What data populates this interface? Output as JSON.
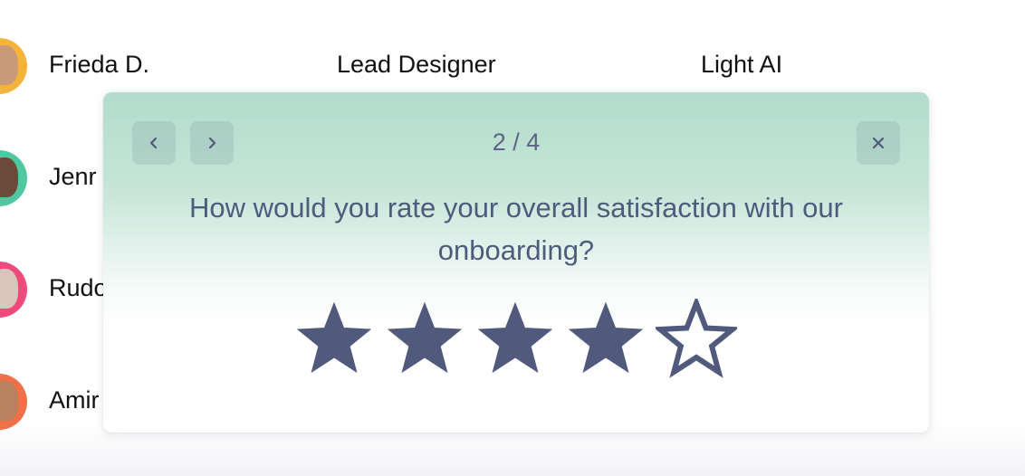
{
  "people": [
    {
      "name": "Frieda D.",
      "role": "Lead Designer",
      "company": "Light AI",
      "avatar_color": "#f4b43c"
    },
    {
      "name": "Jenr",
      "role": "",
      "company": "",
      "avatar_color": "#4fc7a0"
    },
    {
      "name": "Rudo",
      "role": "",
      "company": "",
      "avatar_color": "#ef4a7c"
    },
    {
      "name": "Amir",
      "role": "",
      "company": "",
      "avatar_color": "#f07048"
    }
  ],
  "survey": {
    "progress": "2 / 4",
    "question": "How would you rate your overall satisfaction with our onboarding?",
    "rating": 4,
    "max_rating": 5,
    "icons": {
      "prev": "chevron-left-icon",
      "next": "chevron-right-icon",
      "close": "close-icon",
      "star": "star-icon"
    },
    "colors": {
      "star": "#51597c",
      "header_gradient_top": "#b1dccc"
    }
  }
}
